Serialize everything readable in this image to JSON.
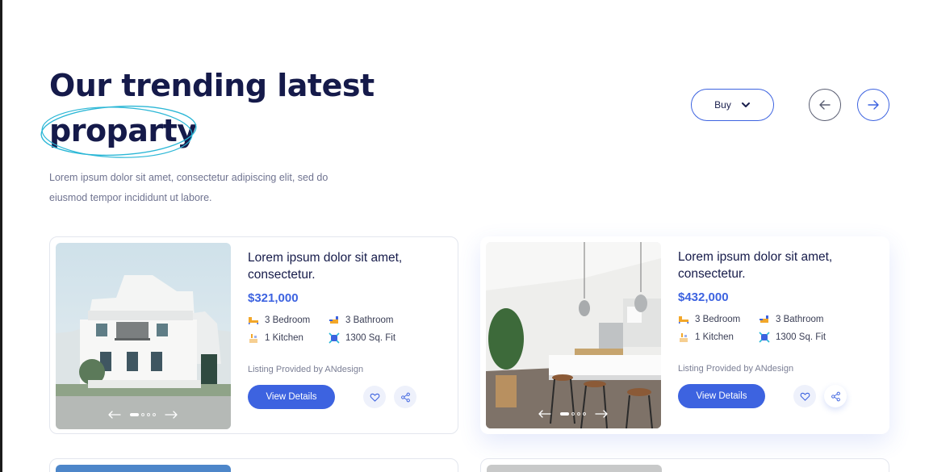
{
  "header": {
    "title_line1": "Our trending latest",
    "title_line2": "proparty",
    "subtitle_line1": "Lorem ipsum dolor sit amet, consectetur adipiscing elit, sed do",
    "subtitle_line2": "eiusmod tempor incididunt ut labore."
  },
  "filter": {
    "selected": "Buy",
    "icon": "chevron-down-icon"
  },
  "carousel_nav": {
    "prev_icon": "arrow-left-icon",
    "next_icon": "arrow-right-icon"
  },
  "listings": [
    {
      "title_line1": "Lorem ipsum dolor sit amet,",
      "title_line2": "consectetur.",
      "price": "$321,000",
      "bedroom": "3 Bedroom",
      "bathroom": "3 Bathroom",
      "kitchen": "1 Kitchen",
      "area": "1300 Sq. Fit",
      "provided_by": "Listing Provided by ANdesign",
      "button": "View Details"
    },
    {
      "title_line1": "Lorem ipsum dolor sit amet,",
      "title_line2": "consectetur.",
      "price": "$432,000",
      "bedroom": "3 Bedroom",
      "bathroom": "3 Bathroom",
      "kitchen": "1 Kitchen",
      "area": "1300 Sq. Fit",
      "provided_by": "Listing Provided by ANdesign",
      "button": "View Details"
    }
  ],
  "colors": {
    "accent": "#3d63e0",
    "title": "#151a4a",
    "scribble": "#2bb7d6"
  }
}
